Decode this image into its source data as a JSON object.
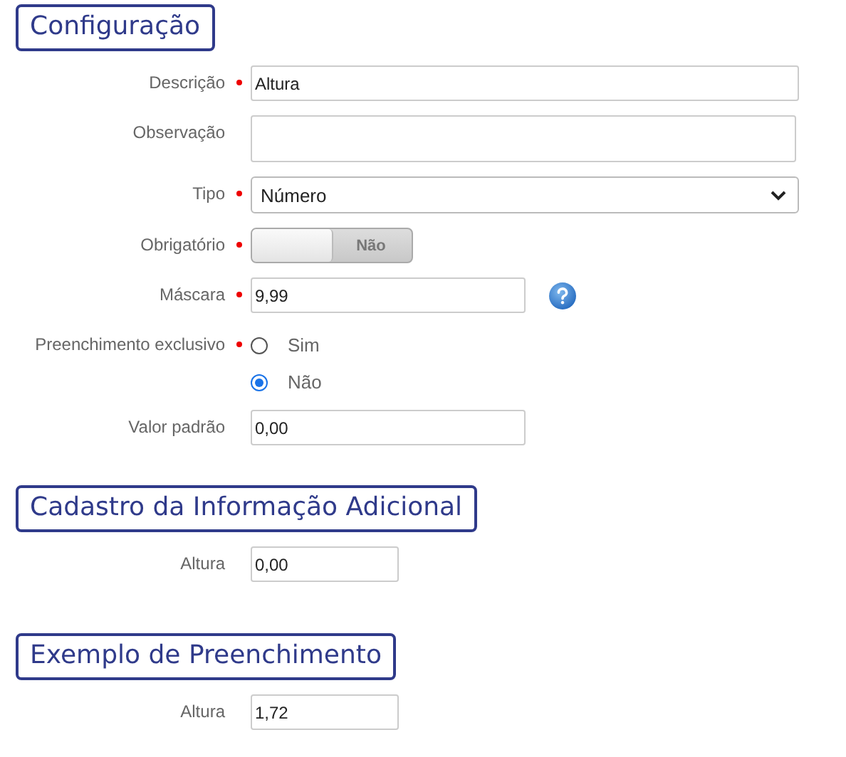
{
  "sections": [
    {
      "heading": "Configuração",
      "fields": [
        {
          "kind": "text",
          "label": "Descrição",
          "required": true,
          "value": "Altura"
        },
        {
          "kind": "textarea",
          "label": "Observação",
          "required": false
        },
        {
          "kind": "select",
          "label": "Tipo",
          "required": true,
          "value": "Número"
        },
        {
          "kind": "toggle",
          "label": "Obrigatório",
          "required": true,
          "on": false,
          "state_text": "Não"
        },
        {
          "kind": "text",
          "label": "Máscara",
          "required": true,
          "value": "9,99",
          "help": true
        },
        {
          "kind": "radio",
          "label": "Preenchimento exclusivo",
          "required": true,
          "options": [
            {
              "label": "Sim",
              "selected": false
            },
            {
              "label": "Não",
              "selected": true
            }
          ]
        },
        {
          "kind": "text",
          "label": "Valor padrão",
          "required": false,
          "value": "0,00"
        }
      ]
    },
    {
      "heading": "Cadastro da Informação Adicional",
      "fields": [
        {
          "kind": "text",
          "label": "Altura",
          "required": false,
          "value": "0,00"
        }
      ]
    },
    {
      "heading": "Exemplo de Preenchimento",
      "fields": [
        {
          "kind": "text",
          "label": "Altura",
          "required": false,
          "value": "1,72"
        }
      ]
    }
  ]
}
